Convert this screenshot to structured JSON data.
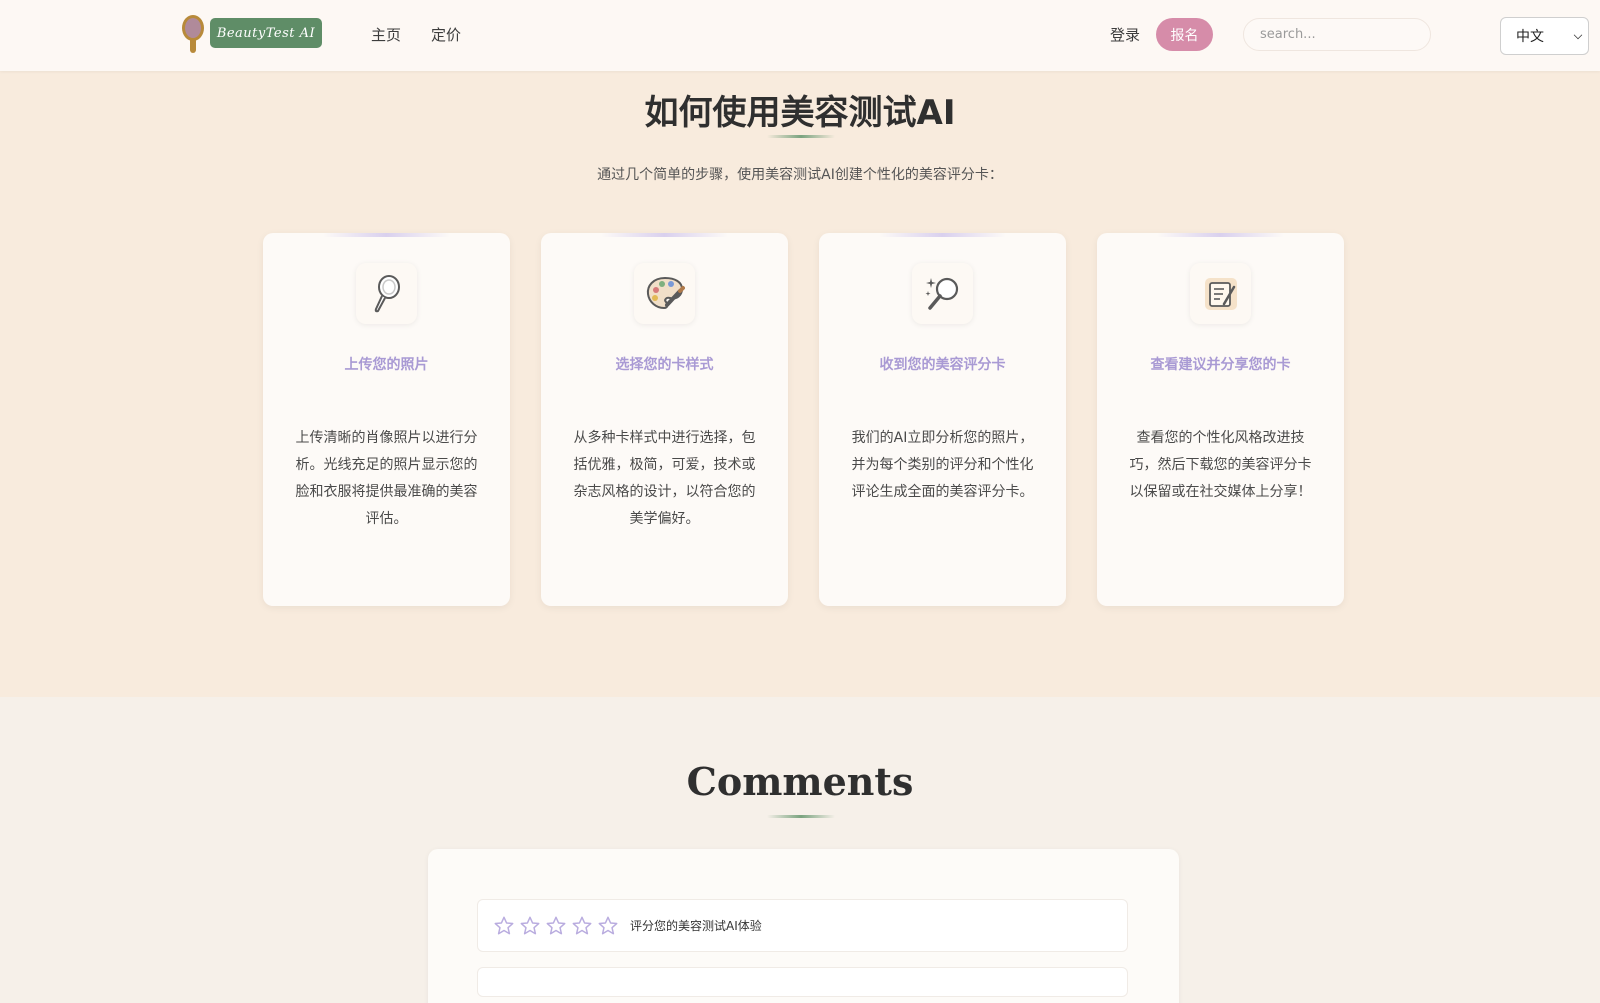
{
  "header": {
    "logo_text": "BeautyTest AI",
    "nav": [
      "主页",
      "定价"
    ],
    "login": "登录",
    "signup": "报名",
    "search_placeholder": "search...",
    "language": "中文"
  },
  "howto": {
    "title": "如何使用美容测试AI",
    "subtitle": "通过几个简单的步骤，使用美容测试AI创建个性化的美容评分卡：",
    "steps": [
      {
        "icon": "hand-mirror-icon",
        "title": "上传您的照片",
        "desc": "上传清晰的肖像照片以进行分析。光线充足的照片显示您的脸和衣服将提供最准确的美容评估。"
      },
      {
        "icon": "palette-icon",
        "title": "选择您的卡样式",
        "desc": "从多种卡样式中进行选择，包括优雅，极简，可爱，技术或杂志风格的设计，以符合您的美学偏好。"
      },
      {
        "icon": "magnifier-sparkle-icon",
        "title": "收到您的美容评分卡",
        "desc": "我们的AI立即分析您的照片，并为每个类别的评分和个性化评论生成全面的美容评分卡。"
      },
      {
        "icon": "notepad-icon",
        "title": "查看建议并分享您的卡",
        "desc": "查看您的个性化风格改进技巧，然后下载您的美容评分卡以保留或在社交媒体上分享！"
      }
    ]
  },
  "comments": {
    "title": "Comments",
    "rating_label": "评分您的美容测试AI体验",
    "rating_value": 0,
    "rating_max": 5,
    "star_color": "#b9acdf"
  }
}
